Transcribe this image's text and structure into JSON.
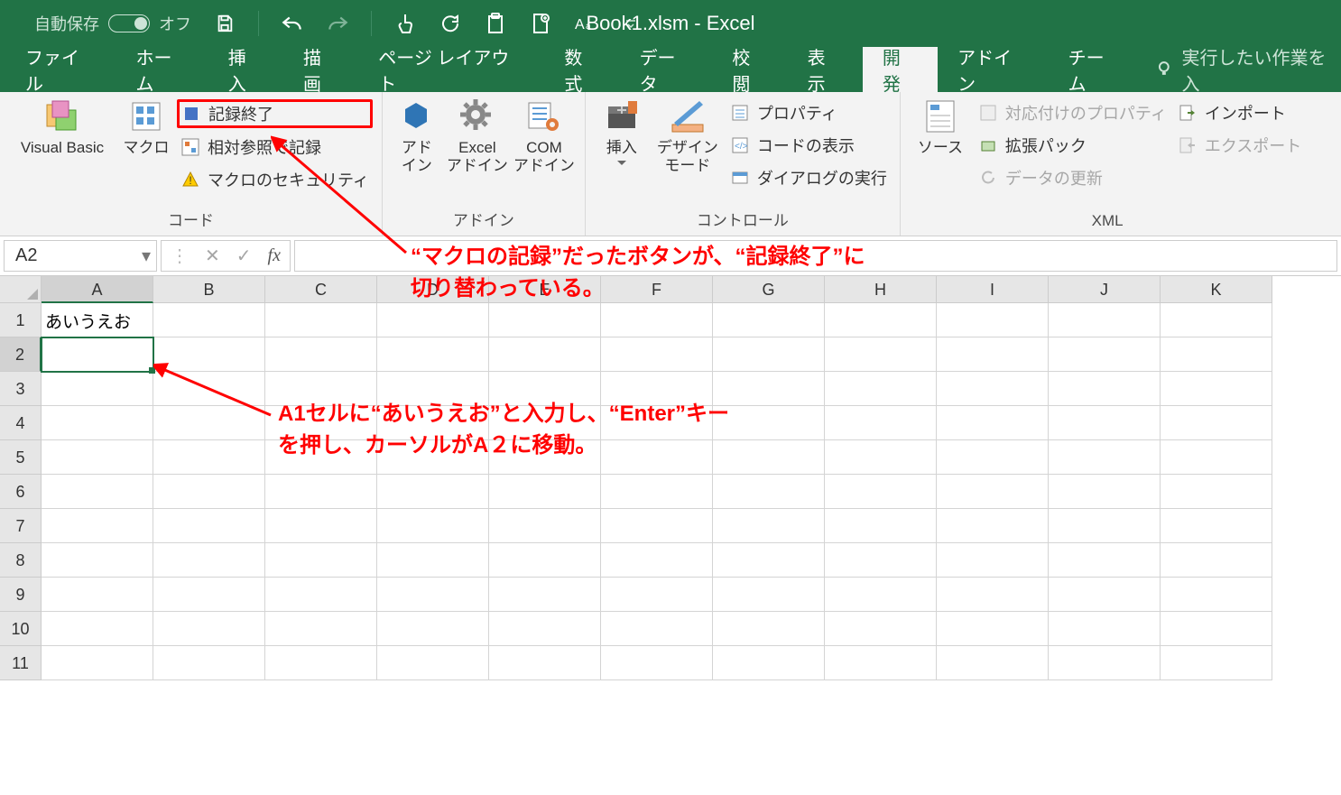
{
  "titlebar": {
    "autosave_label": "自動保存",
    "autosave_state": "オフ",
    "doc_title": "Book1.xlsm  -  Excel"
  },
  "tabs": {
    "items": [
      "ファイル",
      "ホーム",
      "挿入",
      "描画",
      "ページ レイアウト",
      "数式",
      "データ",
      "校閲",
      "表示",
      "開発",
      "アドイン",
      "チーム"
    ],
    "active_index": 9,
    "tellme_placeholder": "実行したい作業を入"
  },
  "ribbon": {
    "code": {
      "vb": "Visual Basic",
      "macros": "マクロ",
      "stop_rec": "記録終了",
      "relative": "相対参照で記録",
      "security": "マクロのセキュリティ",
      "group": "コード"
    },
    "addins": {
      "addin": "アド\nイン",
      "excel_addin": "Excel\nアドイン",
      "com_addin": "COM\nアドイン",
      "group": "アドイン"
    },
    "controls": {
      "insert": "挿入",
      "design": "デザイン\nモード",
      "props": "プロパティ",
      "viewcode": "コードの表示",
      "rundlg": "ダイアログの実行",
      "group": "コントロール"
    },
    "xml": {
      "source": "ソース",
      "mapprops": "対応付けのプロパティ",
      "expansion": "拡張パック",
      "refresh": "データの更新",
      "import": "インポート",
      "export": "エクスポート",
      "group": "XML"
    }
  },
  "formula_bar": {
    "namebox": "A2",
    "value": ""
  },
  "sheet": {
    "columns": [
      "A",
      "B",
      "C",
      "D",
      "E",
      "F",
      "G",
      "H",
      "I",
      "J",
      "K"
    ],
    "rows": [
      1,
      2,
      3,
      4,
      5,
      6,
      7,
      8,
      9,
      10,
      11
    ],
    "active_col_index": 0,
    "active_row_index": 1,
    "cells": {
      "A1": "あいうえお"
    }
  },
  "annotations": {
    "a1": "“マクロの記録”だったボタンが、“記録終了”に\n切り替わっている。",
    "a2": "A1セルに“あいうえお”と入力し、“Enter”キー\nを押し、カーソルがA２に移動。"
  }
}
